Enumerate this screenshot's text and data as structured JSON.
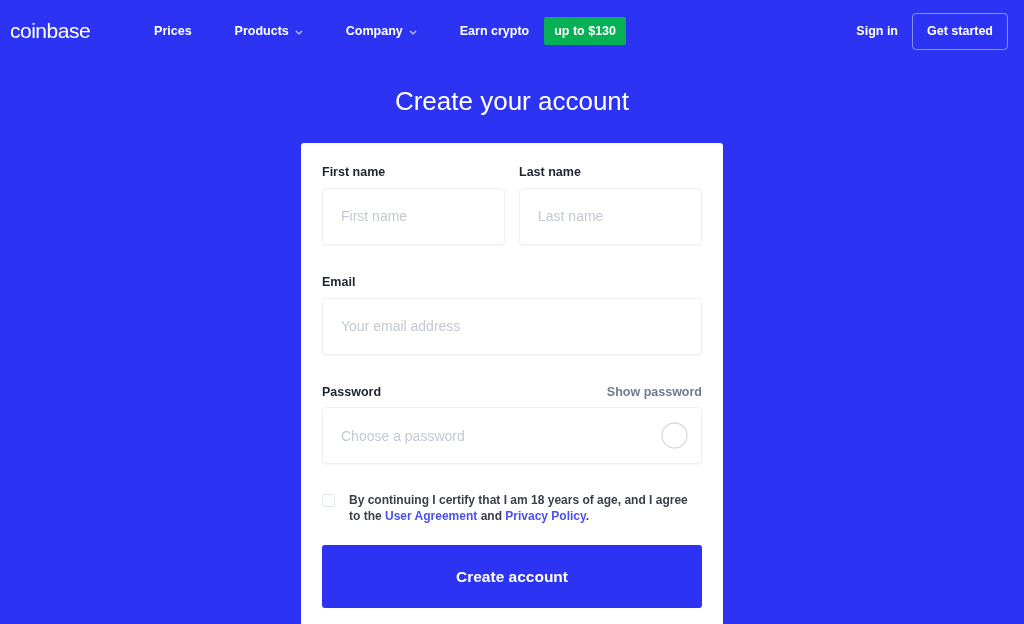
{
  "nav": {
    "logo": "coinbase",
    "items": [
      {
        "label": "Prices",
        "dropdown": false
      },
      {
        "label": "Products",
        "dropdown": true
      },
      {
        "label": "Company",
        "dropdown": true
      },
      {
        "label": "Earn crypto",
        "dropdown": false
      }
    ],
    "promo_badge": "up to $130",
    "sign_in": "Sign in",
    "get_started": "Get started"
  },
  "heading": "Create your account",
  "form": {
    "first_name": {
      "label": "First name",
      "placeholder": "First name"
    },
    "last_name": {
      "label": "Last name",
      "placeholder": "Last name"
    },
    "email": {
      "label": "Email",
      "placeholder": "Your email address"
    },
    "password": {
      "label": "Password",
      "toggle": "Show password",
      "placeholder": "Choose a password"
    },
    "consent": {
      "checked": false,
      "text_before": "By continuing I certify that I am 18 years of age, and I agree to the",
      "link_1": "User Agreement",
      "text_middle": "and",
      "link_2": "Privacy Policy",
      "text_after": "."
    },
    "submit": "Create account"
  }
}
